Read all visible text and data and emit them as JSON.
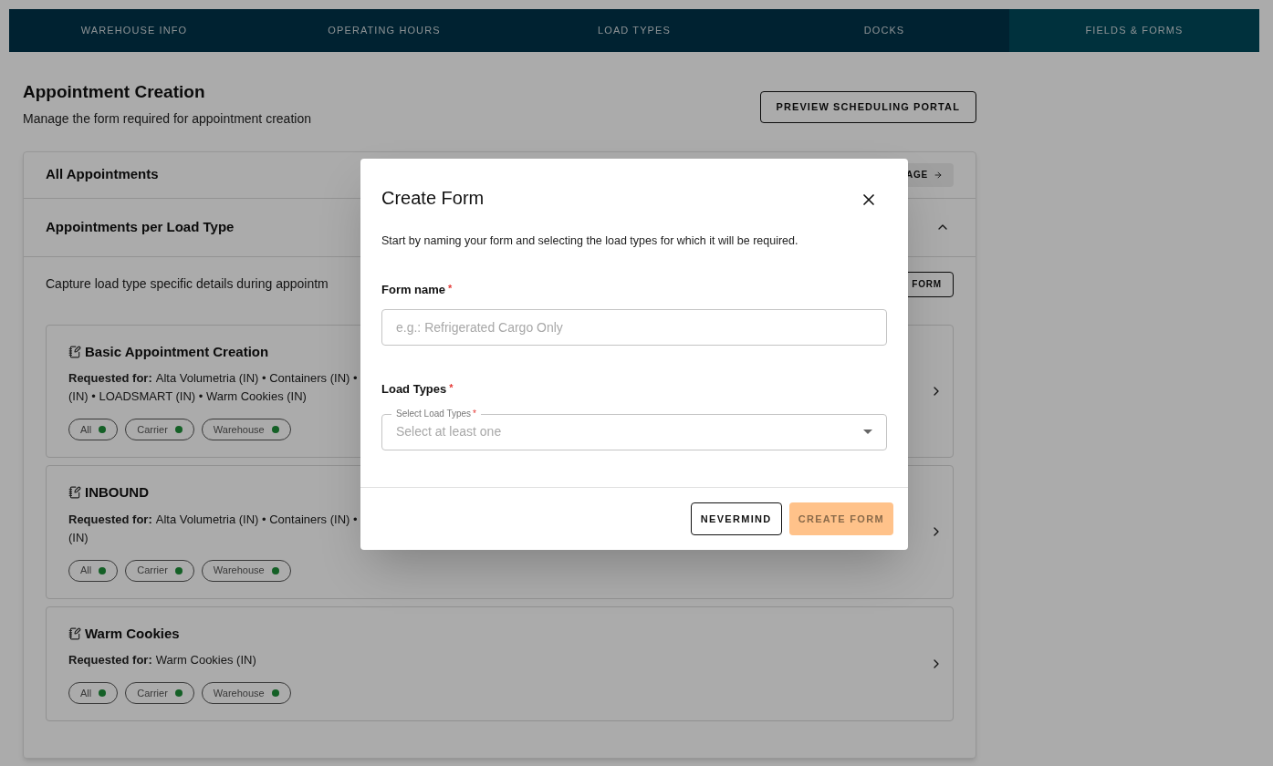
{
  "nav": {
    "tabs": [
      {
        "label": "WAREHOUSE INFO",
        "selected": false
      },
      {
        "label": "OPERATING HOURS",
        "selected": false
      },
      {
        "label": "LOAD TYPES",
        "selected": false
      },
      {
        "label": "DOCKS",
        "selected": false
      },
      {
        "label": "FIELDS & FORMS",
        "selected": true
      }
    ]
  },
  "header": {
    "title": "Appointment Creation",
    "subtitle": "Manage the form required for appointment creation",
    "button": "PREVIEW SCHEDULING PORTAL"
  },
  "all_appointments": {
    "title": "All Appointments",
    "button": "AGE"
  },
  "per_load_type": {
    "title": "Appointments per Load Type",
    "expanded": true,
    "description": "Capture load type specific details during appointm",
    "button": "FORM",
    "forms": [
      {
        "title": "Basic Appointment Creation",
        "requested_label": "Requested for:",
        "lines": [
          "Alta Volumetria (IN) • Containers (IN) •",
          "(IN) • LOADSMART (IN) • Warm Cookies (IN)"
        ],
        "chips": [
          {
            "label": "All",
            "on": true
          },
          {
            "label": "Carrier",
            "on": true
          },
          {
            "label": "Warehouse",
            "on": true
          }
        ]
      },
      {
        "title": "INBOUND",
        "requested_label": "Requested for:",
        "lines": [
          "Alta Volumetria (IN) • Containers (IN) •",
          "(IN)"
        ],
        "chips": [
          {
            "label": "All",
            "on": true
          },
          {
            "label": "Carrier",
            "on": true
          },
          {
            "label": "Warehouse",
            "on": true
          }
        ]
      },
      {
        "title": "Warm Cookies",
        "requested_label": "Requested for:",
        "lines": [
          "Warm Cookies (IN)"
        ],
        "chips": [
          {
            "label": "All",
            "on": true
          },
          {
            "label": "Carrier",
            "on": true
          },
          {
            "label": "Warehouse",
            "on": true
          }
        ]
      }
    ]
  },
  "modal": {
    "title": "Create Form",
    "description": "Start by naming your form and selecting the load types for which it will be required.",
    "form_name": {
      "label": "Form name",
      "required_mark": "*",
      "placeholder": "e.g.: Refrigerated Cargo Only"
    },
    "load_types": {
      "label": "Load Types",
      "required_mark": "*",
      "floating_label": "Select Load Types",
      "floating_required_mark": "*",
      "placeholder": "Select at least one"
    },
    "buttons": [
      {
        "label": "NEVERMIND",
        "kind": "secondary",
        "disabled": false
      },
      {
        "label": "CREATE FORM",
        "kind": "primary",
        "disabled": true
      }
    ]
  }
}
